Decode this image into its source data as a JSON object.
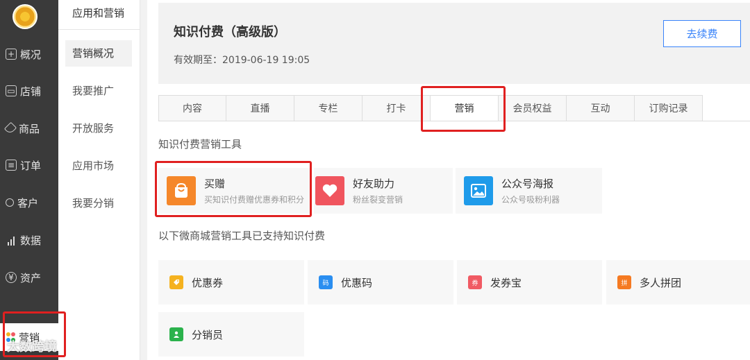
{
  "nav": {
    "items": [
      {
        "label": "概况",
        "icon": "overview-icon"
      },
      {
        "label": "店铺",
        "icon": "shop-icon"
      },
      {
        "label": "商品",
        "icon": "tag-icon"
      },
      {
        "label": "订单",
        "icon": "order-icon"
      },
      {
        "label": "客户",
        "icon": "user-icon"
      },
      {
        "label": "数据",
        "icon": "bar-chart-icon"
      },
      {
        "label": "资产",
        "icon": "yen-icon"
      },
      {
        "label": "营销",
        "icon": "marketing-icon"
      }
    ]
  },
  "subnav": {
    "title": "应用和营销",
    "items": [
      {
        "label": "营销概况"
      },
      {
        "label": "我要推广"
      },
      {
        "label": "开放服务"
      },
      {
        "label": "应用市场"
      },
      {
        "label": "我要分销"
      }
    ]
  },
  "header": {
    "title": "知识付费（高级版）",
    "expire": "有效期至：2019-06-19 19:05",
    "renew_label": "去续费"
  },
  "tabs": [
    {
      "label": "内容"
    },
    {
      "label": "直播"
    },
    {
      "label": "专栏"
    },
    {
      "label": "打卡"
    },
    {
      "label": "营销"
    },
    {
      "label": "会员权益"
    },
    {
      "label": "互动"
    },
    {
      "label": "订购记录"
    }
  ],
  "active_tab": "营销",
  "section1": {
    "label": "知识付费营销工具",
    "tools": [
      {
        "name": "买赠",
        "desc": "买知识付费赠优惠券和积分",
        "color": "#f5872a",
        "icon": "shopping-bag-icon"
      },
      {
        "name": "好友助力",
        "desc": "粉丝裂变营销",
        "color": "#f0555e",
        "icon": "heart-icon"
      },
      {
        "name": "公众号海报",
        "desc": "公众号吸粉利器",
        "color": "#1f9bea",
        "icon": "image-icon"
      }
    ]
  },
  "section2": {
    "label": "以下微商城营销工具已支持知识付费",
    "tools": [
      {
        "name": "优惠券",
        "color": "#f5b21f",
        "icon": "coupon-icon",
        "glyph": ""
      },
      {
        "name": "优惠码",
        "color": "#2a8ef0",
        "icon": "code-icon",
        "glyph": "码"
      },
      {
        "name": "发券宝",
        "color": "#f05a63",
        "icon": "ticket-icon",
        "glyph": "券"
      },
      {
        "name": "多人拼团",
        "color": "#f57a22",
        "icon": "group-buy-icon",
        "glyph": "拼"
      },
      {
        "name": "分销员",
        "color": "#2bb24c",
        "icon": "distributor-icon",
        "glyph": ""
      }
    ]
  },
  "watermark": "大数跨境"
}
